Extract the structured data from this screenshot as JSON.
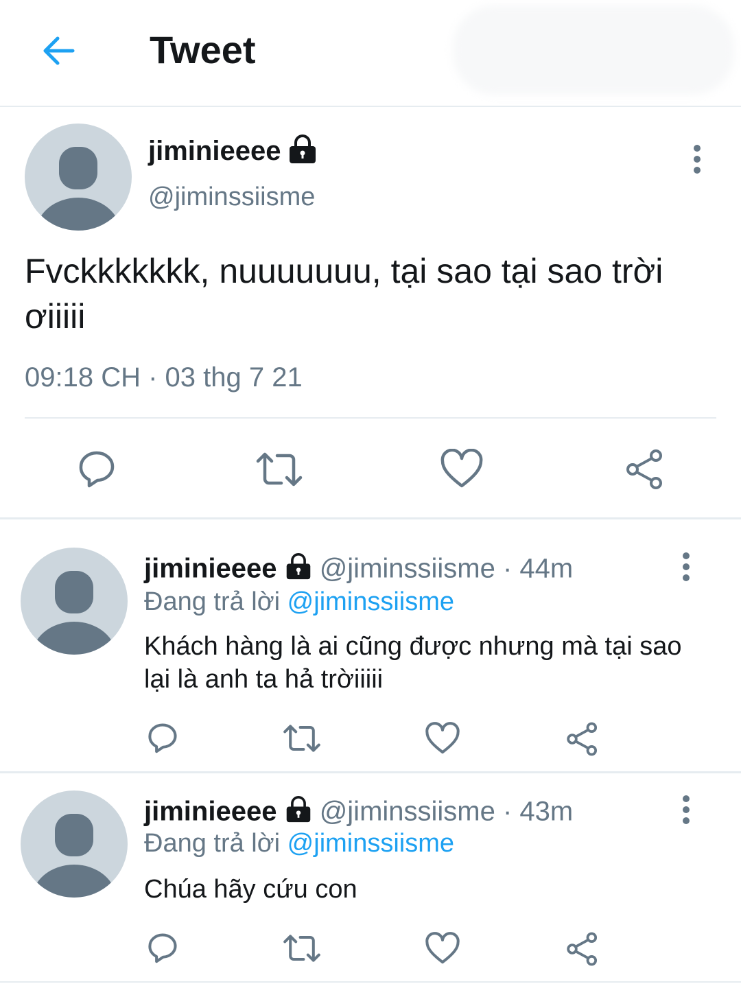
{
  "header": {
    "title": "Tweet"
  },
  "main_tweet": {
    "display_name": "jiminieeee",
    "handle": "@jiminssiisme",
    "text": "Fvckkkkkkk, nuuuuuuu, tại sao tại sao trời ơiiiii",
    "timestamp": "09:18 CH · 03 thg 7 21"
  },
  "replies": [
    {
      "display_name": "jiminieeee",
      "handle": "@jiminssiisme",
      "age": "· 44m",
      "replying_prefix": "Đang trả lời",
      "replying_to": "@jiminssiisme",
      "text": "Khách hàng là ai cũng được nhưng mà tại sao lại là anh ta hả trờiiiii"
    },
    {
      "display_name": "jiminieeee",
      "handle": "@jiminssiisme",
      "age": "· 43m",
      "replying_prefix": "Đang trả lời",
      "replying_to": "@jiminssiisme",
      "text": "Chúa hãy cứu con"
    }
  ],
  "colors": {
    "accent": "#1da1f2",
    "muted": "#657786",
    "icon": "#657786",
    "divider": "#e6ecf0"
  },
  "icons": [
    "back-arrow-icon",
    "lock-icon",
    "more-vertical-icon",
    "reply-icon",
    "retweet-icon",
    "like-icon",
    "share-icon"
  ]
}
